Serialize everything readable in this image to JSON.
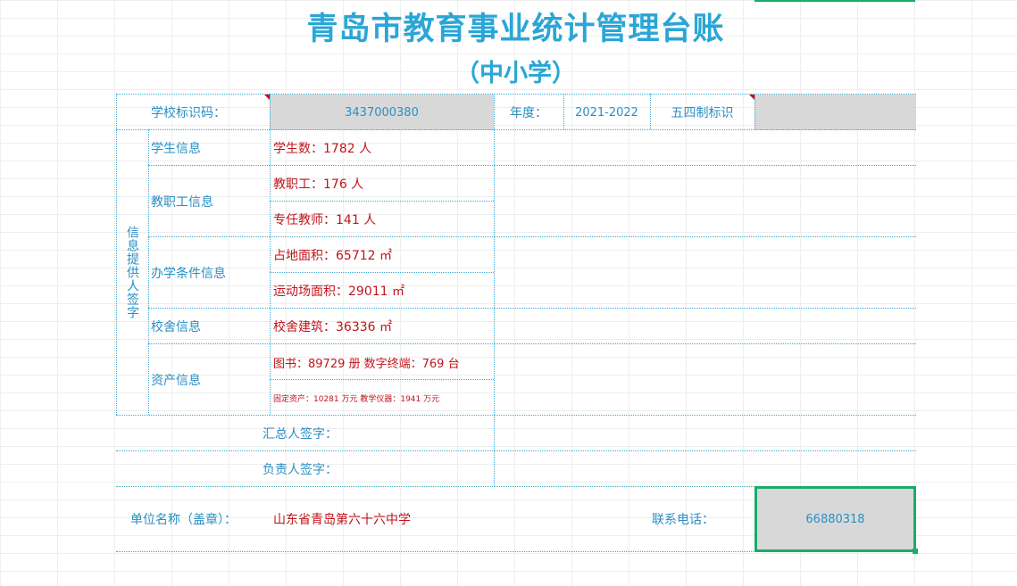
{
  "title": "青岛市教育事业统计管理台账",
  "subtitle": "（中小学）",
  "header": {
    "school_id_label": "学校标识码：",
    "school_id_value": "3437000380",
    "year_label": "年度：",
    "year_value": "2021-2022",
    "system_label": "五四制标识",
    "system_value": ""
  },
  "signer_vertical": "信息提供人签字",
  "sections": {
    "student": {
      "label": "学生信息",
      "row1": "学生数：1782 人"
    },
    "staff": {
      "label": "教职工信息",
      "row1": "教职工：176 人",
      "row2": "专任教师：141 人"
    },
    "facility": {
      "label": "办学条件信息",
      "row1": "占地面积：65712 ㎡",
      "row2": "运动场面积：29011 ㎡"
    },
    "building": {
      "label": "校舍信息",
      "row1": "校舍建筑：36336 ㎡"
    },
    "asset": {
      "label": "资产信息",
      "row1": "图书：89729 册 数字终端：769 台",
      "row2": "固定资产：10281 万元 教学仪器：1941 万元"
    }
  },
  "summary_signer_label": "汇总人签字：",
  "leader_signer_label": "负责人签字：",
  "footer": {
    "unit_label": "单位名称（盖章）：",
    "unit_value": "山东省青岛第六十六中学",
    "phone_label": "联系电话：",
    "phone_value": "66880318"
  },
  "colors": {
    "title": "#2aa6d6",
    "label": "#2a8fc4",
    "value": "#c0151b",
    "border": "#3fa9d5",
    "selection": "#1aab6b",
    "input_bg": "#d8d8d8"
  }
}
